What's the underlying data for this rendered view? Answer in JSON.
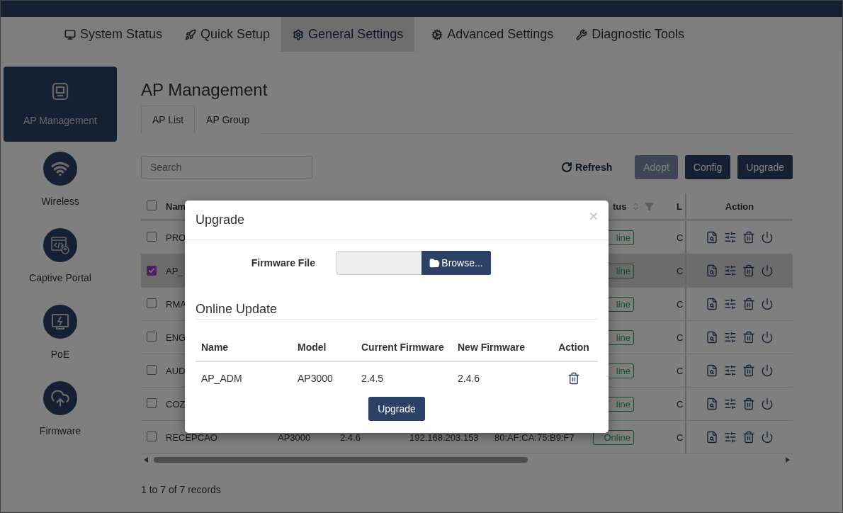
{
  "top_nav": [
    {
      "label": "System Status",
      "kind": "monitor",
      "selected": false
    },
    {
      "label": "Quick Setup",
      "kind": "rocket",
      "selected": false
    },
    {
      "label": "General Settings",
      "kind": "gear",
      "selected": true
    },
    {
      "label": "Advanced Settings",
      "kind": "cogs",
      "selected": false
    },
    {
      "label": "Diagnostic Tools",
      "kind": "tools",
      "selected": false
    }
  ],
  "sidebar": {
    "items": [
      {
        "label": "AP Management",
        "kind": "ap",
        "selected": true
      },
      {
        "label": "Wireless",
        "kind": "wifi",
        "selected": false
      },
      {
        "label": "Captive Portal",
        "kind": "portal",
        "selected": false
      },
      {
        "label": "PoE",
        "kind": "poe",
        "selected": false
      },
      {
        "label": "Firmware",
        "kind": "cloud",
        "selected": false
      }
    ]
  },
  "page": {
    "title": "AP Management",
    "tabs": [
      {
        "label": "AP List",
        "selected": true
      },
      {
        "label": "AP Group",
        "selected": false
      }
    ],
    "search": {
      "placeholder": "Search"
    },
    "buttons": [
      {
        "label": "Refresh",
        "kind": "refresh",
        "disabled": false
      },
      {
        "label": "Adopt",
        "kind": "primary",
        "disabled": true
      },
      {
        "label": "Config",
        "kind": "primary",
        "disabled": false
      },
      {
        "label": "Upgrade",
        "kind": "primary",
        "disabled": false
      }
    ]
  },
  "table": {
    "all_checked": false,
    "columns": [
      {
        "label": "Nam",
        "kind": "name"
      },
      {
        "label": "tus",
        "kind": "status"
      },
      {
        "label": "L",
        "kind": "location"
      },
      {
        "label": "Action",
        "kind": "action"
      }
    ],
    "rows": [
      {
        "checked": false,
        "selected": false,
        "name": "PRO",
        "status": "line",
        "location": "C"
      },
      {
        "checked": true,
        "selected": true,
        "name": "AP_",
        "status": "line",
        "location": "C"
      },
      {
        "checked": false,
        "selected": false,
        "name": "RMA",
        "status": "line",
        "location": "C"
      },
      {
        "checked": false,
        "selected": false,
        "name": "ENG",
        "status": "line",
        "location": "C"
      },
      {
        "checked": false,
        "selected": false,
        "name": "AUD",
        "status": "line",
        "location": "C"
      },
      {
        "checked": false,
        "selected": false,
        "name": "COZ",
        "status": "line",
        "location": "C"
      },
      {
        "checked": false,
        "selected": false,
        "name": "RECEPCAO",
        "model": "AP3000",
        "firmware": "2.4.6",
        "ip": "192.168.203.153",
        "mac": "80:AF:CA:75:B9:F7",
        "status": "Online",
        "location": "C"
      }
    ],
    "footer": "1 to 7 of 7 records"
  },
  "modal": {
    "title": "Upgrade",
    "close": "×",
    "firmware_label": "Firmware File",
    "browse_label": "Browse...",
    "section_title": "Online Update",
    "columns": [
      "Name",
      "Model",
      "Current Firmware",
      "New Firmware",
      "Action"
    ],
    "rows": [
      {
        "name": "AP_ADM",
        "model": "AP3000",
        "current": "2.4.5",
        "new": "2.4.6"
      }
    ],
    "submit": "Upgrade"
  }
}
